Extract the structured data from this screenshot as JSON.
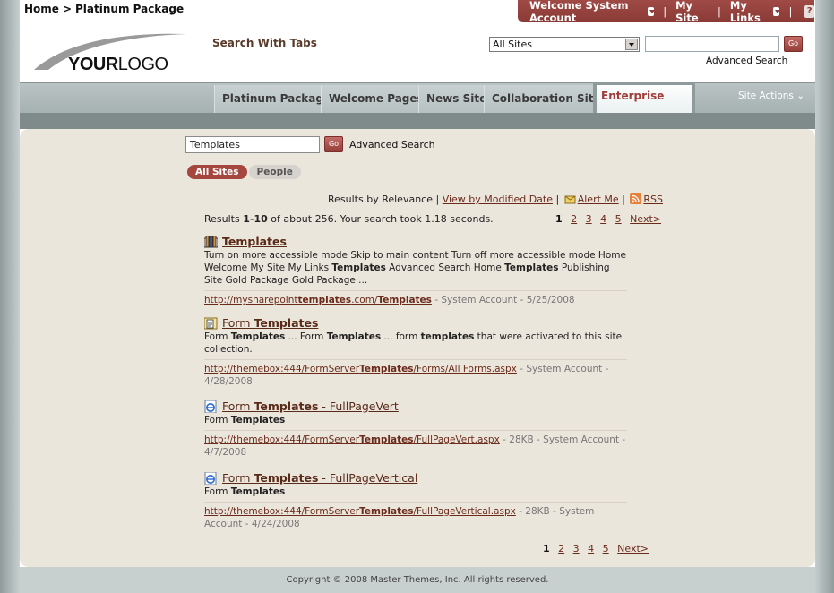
{
  "breadcrumb": {
    "home": "Home",
    "sep": ">",
    "current": "Platinum Package"
  },
  "welcome_bar": {
    "welcome": "Welcome System Account",
    "my_site": "My Site",
    "my_links": "My Links",
    "help": "?"
  },
  "logo": {
    "your": "YOUR",
    "logo": "LOGO"
  },
  "header": {
    "search_tabs_title": "Search With Tabs",
    "scope_value": "All Sites",
    "go_label": "Go",
    "advanced_search": "Advanced Search"
  },
  "nav": {
    "tabs": [
      {
        "label": "Platinum Package"
      },
      {
        "label": "Welcome Pages"
      },
      {
        "label": "News Site"
      },
      {
        "label": "Collaboration Sites"
      },
      {
        "label": "Enterprise Sites"
      }
    ],
    "site_actions": "Site Actions"
  },
  "search": {
    "query": "Templates",
    "go_label": "Go",
    "advanced_search": "Advanced Search",
    "scope_tabs": [
      "All Sites",
      "People"
    ],
    "sort_prefix": "Results by Relevance",
    "sort_alt": "View by Modified Date",
    "alert_me": "Alert Me",
    "rss": "RSS",
    "stats_prefix": "Results ",
    "stats_range": "1-10",
    "stats_suffix": " of about 256. Your search took 1.18 seconds.",
    "pages": [
      "1",
      "2",
      "3",
      "4",
      "5"
    ],
    "next": "Next>"
  },
  "results": [
    {
      "title": "Templates",
      "description": "Turn on more accessible mode Skip to main content Turn off more accessible mode Home Welcome My Site My Links Templates Advanced Search Home Templates Publishing Site Gold Package Gold Package ...",
      "url": "http://mysharepointtemplates.com/Templates",
      "meta": " - System Account - 5/25/2008"
    },
    {
      "title": "Form Templates",
      "description": "Form Templates ... Form Templates ... form templates that were activated to this site collection.",
      "url": "http://themebox:444/FormServerTemplates/Forms/All Forms.aspx",
      "meta": " - System Account - 4/28/2008"
    },
    {
      "title": "Form Templates - FullPageVert",
      "description": "Form Templates",
      "url": "http://themebox:444/FormServerTemplates/FullPageVert.aspx",
      "meta": " - 28KB - System Account - 4/7/2008"
    },
    {
      "title": "Form Templates - FullPageVertical",
      "description": "Form Templates",
      "url": "http://themebox:444/FormServerTemplates/FullPageVertical.aspx",
      "meta": " - 28KB - System Account - 4/24/2008"
    }
  ],
  "footer": {
    "copyright": "Copyright © 2008 Master Themes, Inc. All rights reserved."
  },
  "colors": {
    "accent": "#a5463f",
    "link": "#6b2a1a",
    "nav_bg": "#b9c3c3",
    "content_bg": "#ebe6dc"
  },
  "icons": [
    "dropdown-icon",
    "help-icon",
    "alert-icon",
    "rss-icon",
    "site-icon",
    "form-library-icon",
    "ie-page-icon"
  ]
}
